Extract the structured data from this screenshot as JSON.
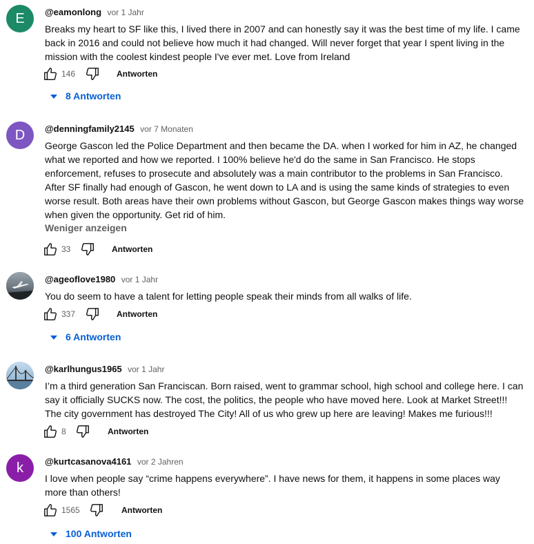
{
  "colors": {
    "reply_link": "#065fd4",
    "meta": "#606060"
  },
  "comments": [
    {
      "author": "@eamonlong",
      "time": "vor 1 Jahr",
      "avatar_letter": "E",
      "avatar_color": "#1c8a66",
      "text": "Breaks my heart to SF like this, I lived there in 2007 and can honestly say it was the best time of my life. I came back in 2016 and could not believe how much it had changed. Will never forget that year I spent living in the mission with the coolest kindest people I've ever met. Love from Ireland",
      "likes": "146",
      "reply_label": "Antworten",
      "replies_label": "8 Antworten"
    },
    {
      "author": "@denningfamily2145",
      "time": "vor 7 Monaten",
      "avatar_letter": "D",
      "avatar_color": "#7e56c2",
      "text": "George Gascon led the Police Department and then became the DA. when I worked for him in AZ, he changed what we reported and how we reported. I 100% believe he'd do the same in San Francisco. He stops enforcement, refuses to prosecute and absolutely was a main contributor to the problems in San Francisco. After SF finally had enough of Gascon, he went down to LA and is using the same kinds of strategies to even worse result. Both areas have their own problems without Gascon, but George Gascon makes things way worse when given the opportunity. Get rid of him.",
      "show_less": "Weniger anzeigen",
      "likes": "33",
      "reply_label": "Antworten"
    },
    {
      "author": "@ageoflove1980",
      "time": "vor 1 Jahr",
      "avatar_icon": "airplane-photo-icon",
      "text": "You do seem to have a talent for letting people speak their minds from all walks of life.",
      "likes": "337",
      "reply_label": "Antworten",
      "replies_label": "6 Antworten"
    },
    {
      "author": "@karlhungus1965",
      "time": "vor 1 Jahr",
      "avatar_icon": "golden-gate-bridge-icon",
      "text": "I’m a third generation San Franciscan. Born raised, went to grammar school, high school and college here. I can say it officially SUCKS now. The cost, the politics, the people who have moved here. Look at Market Street!!! The city government has destroyed The City! All of us who grew up here are leaving! Makes me furious!!!",
      "likes": "8",
      "reply_label": "Antworten"
    },
    {
      "author": "@kurtcasanova4161",
      "time": "vor 2 Jahren",
      "avatar_letter": "k",
      "avatar_color": "#8a1ea8",
      "text": "I love when people say “crime happens everywhere”. I have news for them, it happens in some places way more than others!",
      "likes": "1565",
      "reply_label": "Antworten",
      "replies_label": "100 Antworten"
    }
  ]
}
